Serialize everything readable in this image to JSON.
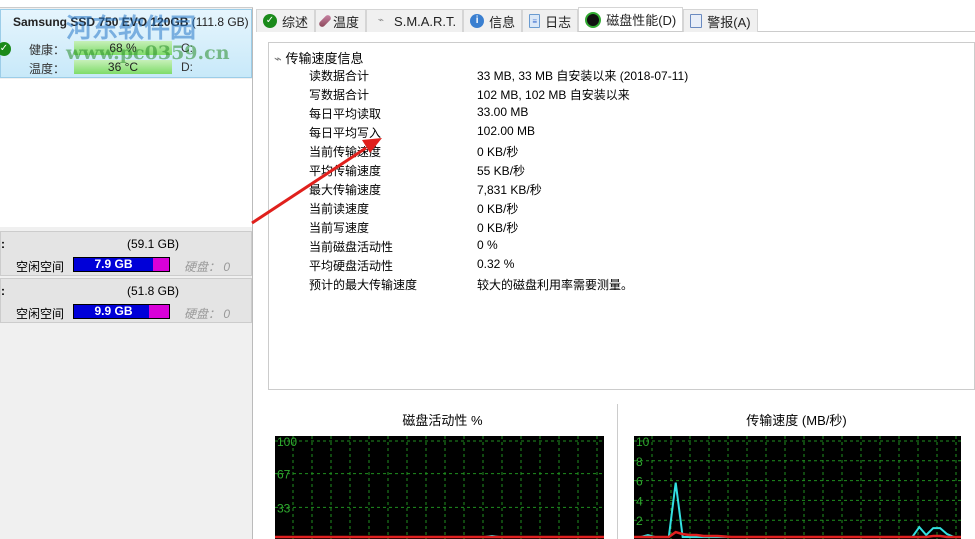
{
  "disk": {
    "name": "Samsung SSD 750 EVO 120GB",
    "size": "(111.8 GB)",
    "health_label": "健康：",
    "health_value": "68 %",
    "temp_label": "温度：",
    "temp_value": "36 °C",
    "drive1": "C:",
    "drive2": "D:"
  },
  "watermark": {
    "line1": "河东软件园",
    "line2": "www.pc0359.cn"
  },
  "drives": [
    {
      "letter": ":",
      "total": "(59.1 GB)",
      "free_label": "空闲空间",
      "free_value": "7.9 GB",
      "hd": "硬盘： 0",
      "used_fraction": 0.13
    },
    {
      "letter": ":",
      "total": "(51.8 GB)",
      "free_label": "空闲空间",
      "free_value": "9.9 GB",
      "hd": "硬盘： 0",
      "used_fraction": 0.19
    }
  ],
  "tabs": [
    {
      "label": "综述",
      "icon": "check-icon"
    },
    {
      "label": "温度",
      "icon": "thermometer-icon"
    },
    {
      "label": "S.M.A.R.T.",
      "icon": "smart-icon"
    },
    {
      "label": "信息",
      "icon": "info-icon"
    },
    {
      "label": "日志",
      "icon": "log-icon"
    },
    {
      "label": "磁盘性能(D)",
      "icon": "gauge-icon",
      "active": true
    },
    {
      "label": "警报(A)",
      "icon": "alert-icon"
    }
  ],
  "info": {
    "title": "传输速度信息",
    "rows": [
      {
        "label": "读数据合计",
        "value": "33 MB,  33 MB 自安装以来  (2018-07-11)"
      },
      {
        "label": "写数据合计",
        "value": "102 MB,  102 MB 自安装以来"
      },
      {
        "label": "每日平均读取",
        "value": "33.00 MB"
      },
      {
        "label": "每日平均写入",
        "value": "102.00 MB"
      },
      {
        "label": "当前传输速度",
        "value": "0 KB/秒"
      },
      {
        "label": "平均传输速度",
        "value": "55 KB/秒"
      },
      {
        "label": "最大传输速度",
        "value": "7,831 KB/秒"
      },
      {
        "label": "当前读速度",
        "value": "0 KB/秒"
      },
      {
        "label": "当前写速度",
        "value": "0 KB/秒"
      },
      {
        "label": "当前磁盘活动性",
        "value": "0 %"
      },
      {
        "label": "平均硬盘活动性",
        "value": "0.32 %"
      },
      {
        "label": "预计的最大传输速度",
        "value": "较大的磁盘利用率需要测量。"
      }
    ]
  },
  "chart_data": [
    {
      "type": "line",
      "title": "磁盘活动性 %",
      "ylim": [
        0,
        100
      ],
      "yticks": [
        "100",
        "67",
        "33"
      ],
      "ytick_values": [
        100,
        67,
        33
      ],
      "grid": true,
      "series": [
        {
          "name": "activity",
          "color": "#33e0e0",
          "values": [
            0,
            1,
            0,
            2,
            1,
            1,
            0,
            1,
            0,
            0,
            0,
            0,
            1,
            0,
            0,
            0,
            0,
            0,
            0,
            0,
            0,
            0,
            0,
            0,
            0,
            0,
            0,
            0,
            0,
            0,
            0,
            4,
            0,
            0,
            0,
            0,
            0,
            0,
            0,
            0,
            1,
            2,
            2,
            1,
            0,
            0,
            0,
            0
          ]
        },
        {
          "name": "average",
          "color": "#e02020",
          "values": [
            0,
            0,
            0,
            0,
            0,
            0,
            0,
            0,
            0,
            0,
            0,
            0,
            0,
            0,
            0,
            0,
            0,
            0,
            0,
            0,
            0,
            0,
            0,
            0,
            0,
            0,
            0,
            0,
            0,
            0,
            0,
            0,
            0,
            0,
            0,
            0,
            0,
            0,
            0,
            0,
            0,
            0,
            0,
            0,
            0,
            0,
            0,
            0
          ]
        }
      ]
    },
    {
      "type": "line",
      "title": "传输速度 (MB/秒)",
      "ylim": [
        0,
        10
      ],
      "yticks": [
        "10",
        "8",
        "6",
        "4",
        "2"
      ],
      "ytick_values": [
        10,
        8,
        6,
        4,
        2
      ],
      "grid": true,
      "series": [
        {
          "name": "transfer",
          "color": "#33e0e0",
          "values": [
            0,
            0,
            0.5,
            0,
            0,
            0,
            5.8,
            0,
            0,
            0.1,
            0.2,
            0,
            0,
            0,
            0,
            0,
            0,
            0,
            0,
            0,
            0,
            0,
            0,
            0,
            0,
            0,
            0,
            0,
            0,
            0,
            0.3,
            0,
            0,
            0,
            0,
            0,
            0,
            0,
            0,
            0,
            0,
            1.3,
            0.5,
            1.2,
            1.2,
            0.6,
            0,
            0
          ]
        },
        {
          "name": "average",
          "color": "#e02020",
          "values": [
            0,
            0,
            0,
            0,
            0,
            0,
            0.8,
            0.6,
            0.5,
            0.5,
            0.4,
            0.4,
            0.4,
            0.35,
            0.3,
            0.3,
            0.3,
            0.3,
            0.3,
            0.25,
            0.25,
            0.25,
            0.25,
            0.25,
            0.2,
            0.2,
            0.2,
            0.2,
            0.2,
            0.2,
            0.2,
            0.2,
            0.2,
            0.2,
            0.2,
            0.2,
            0.2,
            0.2,
            0.2,
            0.2,
            0.2,
            0.2,
            0.3,
            0.4,
            0.4,
            0.3,
            0.2,
            0.2
          ]
        }
      ]
    }
  ]
}
